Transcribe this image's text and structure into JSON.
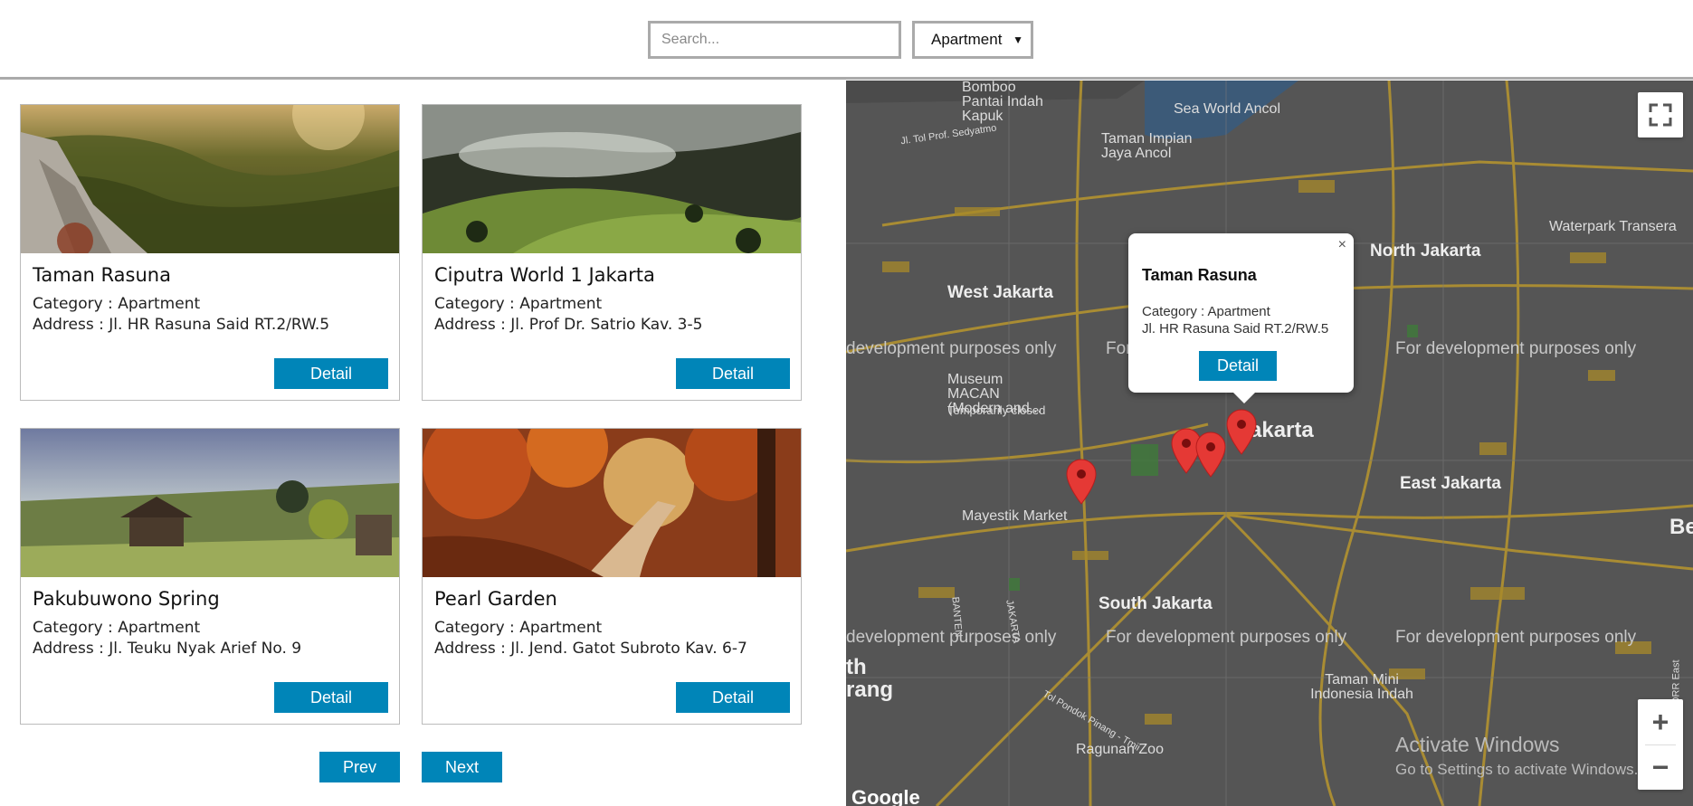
{
  "search": {
    "placeholder": "Search..."
  },
  "filter": {
    "selected": "Apartment",
    "arrow": "▼"
  },
  "listings": [
    {
      "title": "Taman Rasuna",
      "category": "Category : Apartment",
      "address": "Address : Jl. HR Rasuna Said RT.2/RW.5",
      "button": "Detail"
    },
    {
      "title": "Ciputra World 1 Jakarta",
      "category": "Category : Apartment",
      "address": "Address : Jl. Prof Dr. Satrio Kav. 3-5",
      "button": "Detail"
    },
    {
      "title": "Pakubuwono Spring",
      "category": "Category : Apartment",
      "address": "Address : Jl. Teuku Nyak Arief No. 9",
      "button": "Detail"
    },
    {
      "title": "Pearl Garden",
      "category": "Category : Apartment",
      "address": "Address : Jl. Jend. Gatot Subroto Kav. 6-7",
      "button": "Detail"
    }
  ],
  "pager": {
    "prev": "Prev",
    "next": "Next"
  },
  "map": {
    "labels": {
      "north_jakarta": "North Jakarta",
      "west_jakarta": "West Jakarta",
      "east_jakarta": "East Jakarta",
      "south_jakarta": "South Jakarta",
      "jakarta": "akarta",
      "sea_world": "Sea World Ancol",
      "taman_impian": "Taman Impian Jaya Ancol",
      "bomboo": "Bomboo Pantai Indah Kapuk",
      "waterpark": "Waterpark Transera",
      "museum": "Museum MACAN (Modern and...",
      "museum_note": "Temporarily closed",
      "mayestik": "Mayestik Market",
      "tmii": "Taman Mini Indonesia Indah",
      "ragunan": "Ragunan Zoo",
      "be": "Be",
      "th": "th",
      "rang": "rang",
      "sedyatmo": "Jl. Tol Prof. Sedyatmo",
      "pondok": "Tol Pondok Pinang - Tmii",
      "banten": "BANTEN",
      "jakarta_prov": "JAKARTA",
      "jorr": "JORR East"
    },
    "watermark": "For development purposes only",
    "watermark_left": "development purposes only",
    "watermark_cut": "For",
    "popup": {
      "title": "Taman Rasuna",
      "category": "Category : Apartment",
      "address": "Jl. HR Rasuna Said RT.2/RW.5",
      "button": "Detail",
      "close": "×"
    },
    "zoom_in": "+",
    "zoom_out": "−",
    "google": "Google"
  },
  "os_overlay": {
    "title": "Activate Windows",
    "subtitle": "Go to Settings to activate Windows."
  }
}
